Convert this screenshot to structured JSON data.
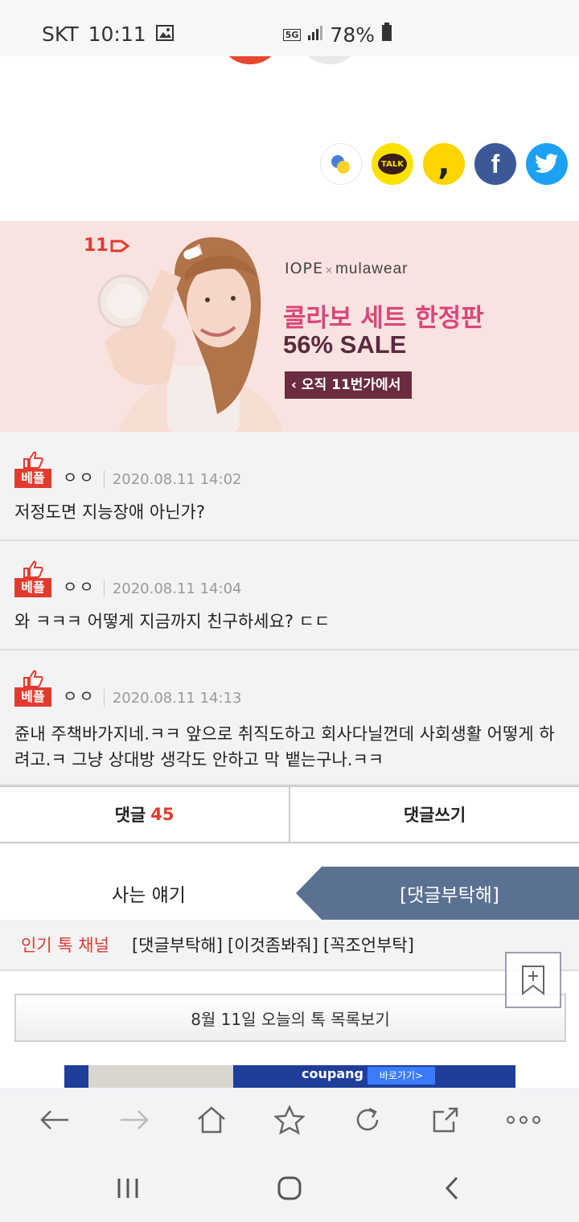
{
  "status_bar": {
    "carrier": "SKT",
    "time": "10:11",
    "network": "5G",
    "battery": "78%"
  },
  "share": {
    "items": [
      {
        "name": "kakaostory",
        "label": ""
      },
      {
        "name": "kakaotalk",
        "label": "TALK"
      },
      {
        "name": "comma",
        "label": ","
      },
      {
        "name": "facebook",
        "label": "f"
      },
      {
        "name": "twitter",
        "label": ""
      }
    ]
  },
  "banner": {
    "store_logo": "11",
    "brand": "IOPE",
    "brand_x": "×",
    "brand_collab": "mulawear",
    "headline": "콜라보 세트 한정판",
    "sale": "56% SALE",
    "cta": "‹ 오직 11번가에서"
  },
  "comments": [
    {
      "badge": "베플",
      "author": "ㅇㅇ",
      "date": "2020.08.11 14:02",
      "text": "저정도면 지능장애 아닌가?"
    },
    {
      "badge": "베플",
      "author": "ㅇㅇ",
      "date": "2020.08.11 14:04",
      "text": "와 ㅋㅋㅋ 어떻게 지금까지 친구하세요? ㄷㄷ"
    },
    {
      "badge": "베플",
      "author": "ㅇㅇ",
      "date": "2020.08.11 14:13",
      "text": "쥰내 주책바가지네.ㅋㅋ 앞으로 취직도하고 회사다닐껀데 사회생활 어떻게 하려고.ㅋ 그냥 상대방 생각도 안하고 막 뱉는구나.ㅋㅋ"
    }
  ],
  "comment_tabs": {
    "comments_label": "댓글",
    "comments_count": "45",
    "write_label": "댓글쓰기"
  },
  "channel_nav": {
    "left": "사는 얘기",
    "right": "[댓글부탁해]"
  },
  "popular": {
    "label": "인기 톡 채널",
    "links": [
      "[댓글부탁해]",
      "[이것좀봐줘]",
      "[꼭조언부탁]"
    ]
  },
  "list_button": "8월 11일 오늘의 톡 목록보기",
  "ad": {
    "brand": "coupang",
    "cta": "바로가기>"
  },
  "colors": {
    "accent_red": "#e23b2e",
    "nav_blue": "#5b7191",
    "banner_bg": "#f9e3e0",
    "sale_purple": "#5a2a3e",
    "headline_pink": "#d9467a"
  }
}
